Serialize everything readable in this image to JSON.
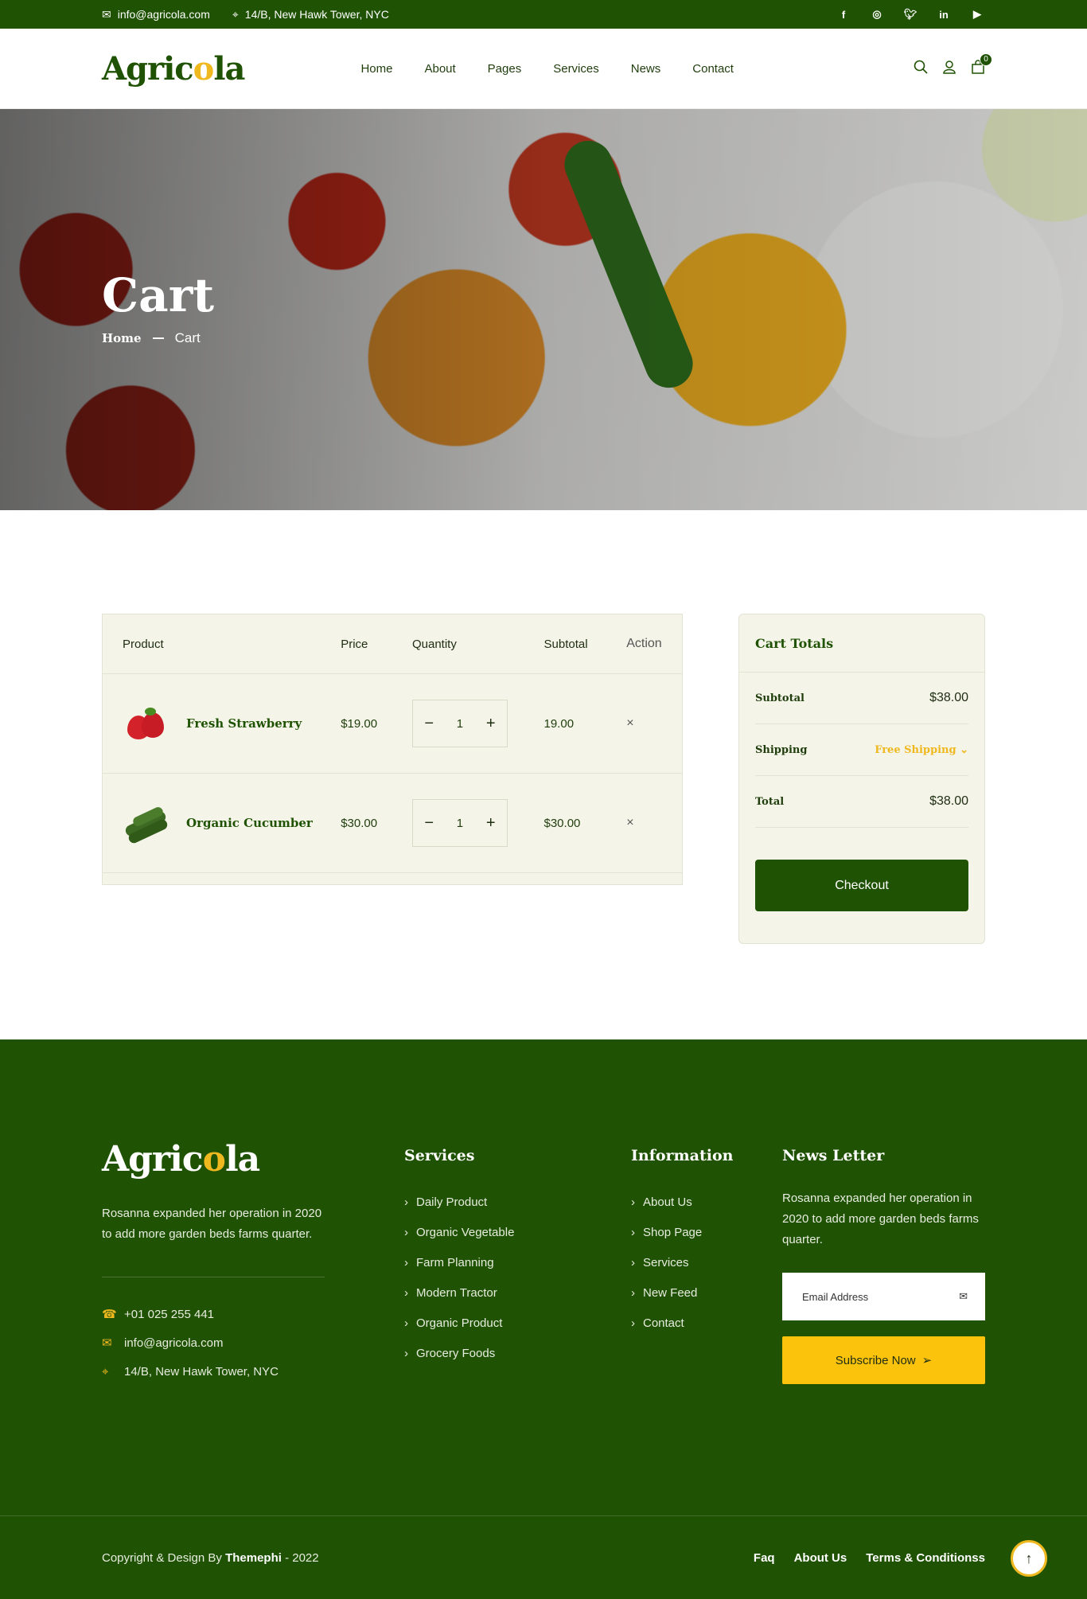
{
  "topbar": {
    "email": "info@agricola.com",
    "address": "14/B, New Hawk Tower, NYC",
    "socials": [
      "f",
      "ig",
      "tw",
      "in",
      "yt"
    ]
  },
  "header": {
    "logo_pre": "Agric",
    "logo_accent": "o",
    "logo_post": "la",
    "nav": [
      "Home",
      "About",
      "Pages",
      "Services",
      "News",
      "Contact"
    ],
    "cart_count": "0"
  },
  "hero": {
    "title": "Cart",
    "breadcrumb_home": "Home",
    "breadcrumb_current": "Cart"
  },
  "cart": {
    "headers": {
      "product": "Product",
      "price": "Price",
      "quantity": "Quantity",
      "subtotal": "Subtotal",
      "action": "Action"
    },
    "items": [
      {
        "name": "Fresh Strawberry",
        "price": "$19.00",
        "qty": "1",
        "subtotal": "19.00"
      },
      {
        "name": "Organic Cucumber",
        "price": "$30.00",
        "qty": "1",
        "subtotal": "$30.00"
      }
    ],
    "minus": "−",
    "plus": "+",
    "remove": "×"
  },
  "totals": {
    "title": "Cart Totals",
    "subtotal_label": "Subtotal",
    "subtotal_value": "$38.00",
    "shipping_label": "Shipping",
    "shipping_value": "Free Shipping",
    "total_label": "Total",
    "total_value": "$38.00",
    "checkout": "Checkout"
  },
  "footer": {
    "logo_pre": "Agric",
    "logo_accent": "o",
    "logo_post": "la",
    "desc": "Rosanna expanded her operation in 2020 to add more garden beds farms quarter.",
    "phone": "+01 025 255 441",
    "email": "info@agricola.com",
    "address": "14/B, New Hawk Tower, NYC",
    "services_title": "Services",
    "services": [
      "Daily Product",
      "Organic Vegetable",
      "Farm Planning",
      "Modern Tractor",
      "Organic Product",
      "Grocery Foods"
    ],
    "info_title": "Information",
    "info": [
      "About Us",
      "Shop Page",
      "Services",
      "New Feed",
      "Contact"
    ],
    "newsletter_title": "News Letter",
    "newsletter_desc": "Rosanna expanded her operation in 2020 to add more garden beds farms quarter.",
    "email_placeholder": "Email Address",
    "subscribe": "Subscribe Now",
    "copyright_pre": "Copyright & Design By ",
    "copyright_brand": "Themephi",
    "copyright_post": " - 2022",
    "bottom_links": [
      "Faq",
      "About Us",
      "Terms & Conditionss"
    ]
  },
  "colors": {
    "primary": "#1f5203",
    "accent": "#f0b81f",
    "yellow": "#fcc30c",
    "cream": "#f4f4e8"
  }
}
